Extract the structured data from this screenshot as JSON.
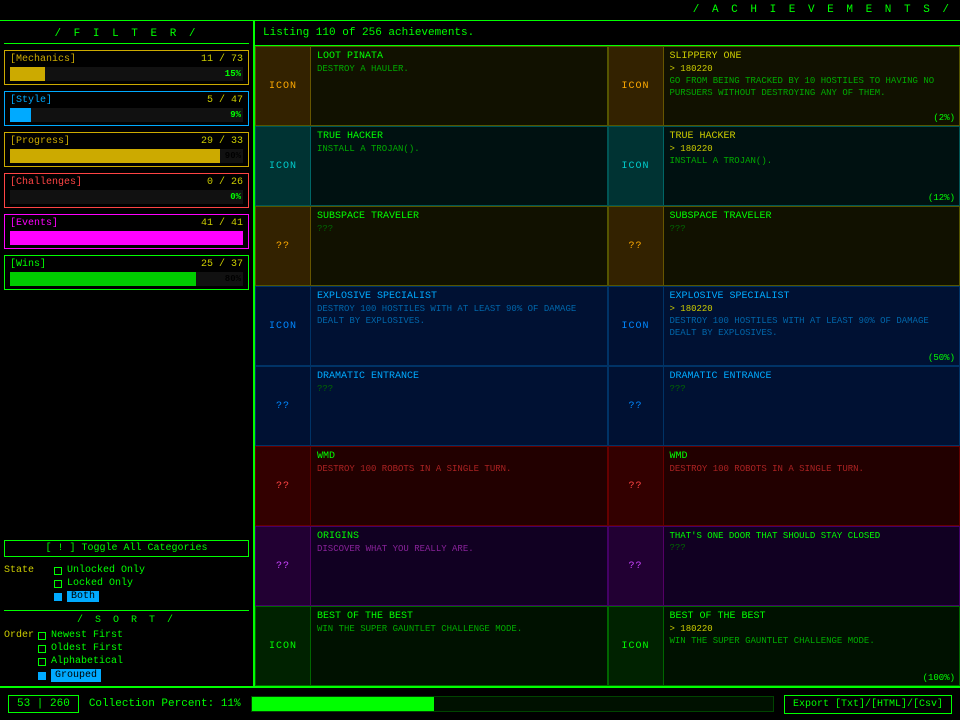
{
  "header": {
    "title": "/ A C H I E V E M E N T S /",
    "listing": "Listing 110 of 256 achievements."
  },
  "filter": {
    "title": "/ F I L T E R /",
    "categories": [
      {
        "key": "mechanics",
        "label": "[Mechanics]",
        "current": 11,
        "total": 73,
        "pct": "15%",
        "pct_val": 15
      },
      {
        "key": "style",
        "label": "[Style]",
        "current": 5,
        "total": 47,
        "pct": "9%",
        "pct_val": 9
      },
      {
        "key": "progress",
        "label": "[Progress]",
        "current": 29,
        "total": 33,
        "pct": "90%",
        "pct_val": 90
      },
      {
        "key": "challenges",
        "label": "[Challenges]",
        "current": 0,
        "total": 26,
        "pct": "0%",
        "pct_val": 0
      },
      {
        "key": "events",
        "label": "[Events]",
        "current": 41,
        "total": 41,
        "pct": "",
        "pct_val": 100
      },
      {
        "key": "wins",
        "label": "[Wins]",
        "current": 25,
        "total": 37,
        "pct": "80%",
        "pct_val": 80
      }
    ],
    "toggle_label": "[ ! ] Toggle All Categories",
    "state_label": "State",
    "state_options": [
      {
        "label": "Unlocked Only",
        "selected": false
      },
      {
        "label": "Locked Only",
        "selected": false
      },
      {
        "label": "Both",
        "selected": true
      }
    ]
  },
  "sort": {
    "title": "/ S O R T /",
    "order_label": "Order",
    "options": [
      {
        "label": "Newest First",
        "selected": false
      },
      {
        "label": "Oldest First",
        "selected": false
      },
      {
        "label": "Alphabetical",
        "selected": false
      },
      {
        "label": "Grouped",
        "selected": true
      }
    ]
  },
  "achievements": [
    {
      "name": "Loot Pinata",
      "desc": "Destroy a Hauler.",
      "icon": "ICON",
      "icon_type": "gold",
      "bg": "gold",
      "progress": "",
      "name_color": "default",
      "col": 0
    },
    {
      "name": "Slippery One",
      "desc": "Go from being tracked by 10 hostiles to having no pursuers without destroying any of them.",
      "icon": "ICON",
      "icon_type": "gold",
      "bg": "gold",
      "progress": "> 180220",
      "pct_label": "(2%)",
      "name_color": "yellow",
      "col": 1
    },
    {
      "name": "True Hacker",
      "desc": "Install a Trojan().",
      "icon": "ICON",
      "icon_type": "teal",
      "bg": "teal",
      "progress": "",
      "name_color": "default",
      "col": 0
    },
    {
      "name": "True Hacker",
      "desc": "Install a Trojan().",
      "icon": "ICON",
      "icon_type": "teal",
      "bg": "teal",
      "progress": "> 180220",
      "pct_label": "(12%)",
      "name_color": "yellow",
      "col": 1
    },
    {
      "name": "Subspace Traveler",
      "desc": "???",
      "icon": "??",
      "icon_type": "gold",
      "bg": "gold",
      "progress": "",
      "name_color": "default",
      "col": 0
    },
    {
      "name": "Subspace Traveler",
      "desc": "???",
      "icon": "??",
      "icon_type": "gold",
      "bg": "gold",
      "progress": "",
      "name_color": "default",
      "col": 1
    },
    {
      "name": "Explosive Specialist",
      "desc": "Destroy 100 hostiles with at least 90% of damage dealt by explosives.",
      "icon": "ICON",
      "icon_type": "blue",
      "bg": "blue",
      "progress": "",
      "name_color": "blue",
      "col": 0
    },
    {
      "name": "Explosive Specialist",
      "desc": "Destroy 100 hostiles with at least 90% of damage dealt by explosives.",
      "icon": "ICON",
      "icon_type": "blue",
      "bg": "blue",
      "progress": "> 180220",
      "pct_label": "(50%)",
      "name_color": "blue",
      "col": 1
    },
    {
      "name": "Dramatic Entrance",
      "desc": "???",
      "icon": "??",
      "icon_type": "blue",
      "bg": "blue",
      "progress": "",
      "name_color": "blue",
      "col": 0
    },
    {
      "name": "Dramatic Entrance",
      "desc": "???",
      "icon": "??",
      "icon_type": "blue",
      "bg": "blue",
      "progress": "",
      "name_color": "blue",
      "col": 1
    },
    {
      "name": "WMD",
      "desc": "Destroy 100 robots in a single turn.",
      "icon": "??",
      "icon_type": "red",
      "bg": "red",
      "progress": "",
      "name_color": "default",
      "col": 0
    },
    {
      "name": "WMD",
      "desc": "Destroy 100 robots in a single turn.",
      "icon": "??",
      "icon_type": "red",
      "bg": "red",
      "progress": "",
      "name_color": "default",
      "col": 1
    },
    {
      "name": "Origins",
      "desc": "Discover what you really are.",
      "icon": "??",
      "icon_type": "purple",
      "bg": "purple",
      "progress": "",
      "name_color": "default",
      "col": 0
    },
    {
      "name": "That's One Door That Should Stay Closed",
      "desc": "???",
      "icon": "??",
      "icon_type": "purple",
      "bg": "purple",
      "progress": "",
      "name_color": "default",
      "col": 1
    },
    {
      "name": "Best of the Best",
      "desc": "Win the Super Gauntlet challenge mode.",
      "icon": "ICON",
      "icon_type": "green",
      "bg": "green",
      "progress": "",
      "name_color": "default",
      "col": 0
    },
    {
      "name": "Best of the Best",
      "desc": "Win the Super Gauntlet challenge mode.",
      "icon": "ICON",
      "icon_type": "green",
      "bg": "green",
      "progress": "> 180220",
      "pct_label": "(100%)",
      "name_color": "default",
      "col": 1
    }
  ],
  "bottom": {
    "count": "53 | 260",
    "collection_label": "Collection Percent: 11%",
    "export_label": "Export [Txt]/[HTML]/[Csv]"
  }
}
